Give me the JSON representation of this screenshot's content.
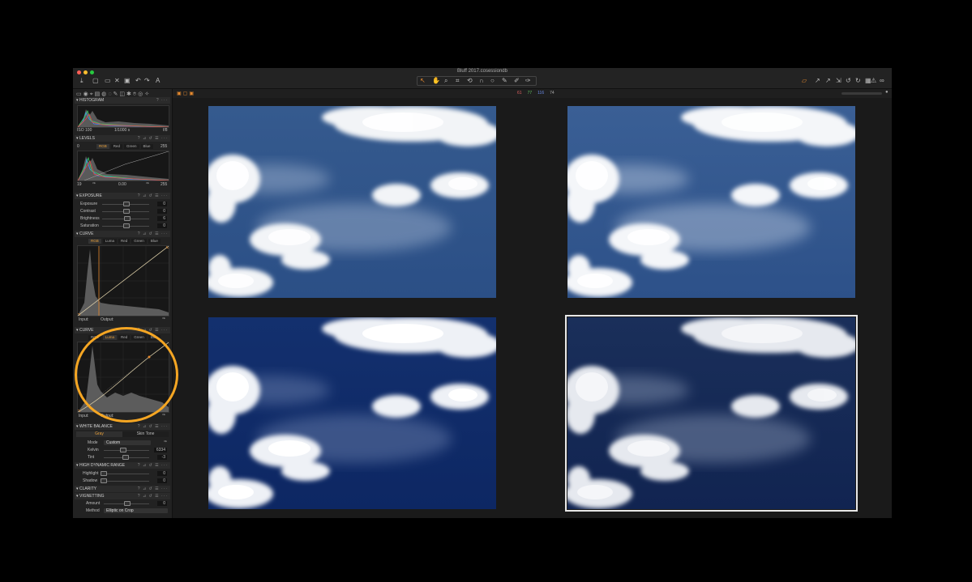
{
  "window": {
    "title": "Bluff 2017.cosessiondb",
    "lights": [
      "#ff5f56",
      "#ffbd2e",
      "#27c93f"
    ]
  },
  "toolbar": {
    "left_icons": [
      "import-icon",
      "camera-icon",
      "folder-icon",
      "close-icon",
      "undo-icon",
      "redo-icon",
      "text-icon"
    ],
    "center_tools": [
      "cursor-tool",
      "pan-tool",
      "zoom-tool",
      "crop-tool",
      "rotate-tool",
      "keystone-tool",
      "spot-tool",
      "brush-tool",
      "eraser-tool",
      "picker-tool"
    ],
    "right_icons": [
      "layers-icon",
      "arrow-icon",
      "edit-icon",
      "reset-icon",
      "redo-icon",
      "grid-icon",
      "warning-icon",
      "glasses-icon"
    ],
    "accent": "#e68a2e"
  },
  "readout": {
    "r": "61",
    "g": "77",
    "b": "116",
    "l": "74"
  },
  "histogram": {
    "title": "HISTOGRAM",
    "iso": "ISO 100",
    "shutter": "1/1000 s",
    "aperture": "f/8"
  },
  "levels": {
    "title": "LEVELS",
    "low": "0",
    "high": "255",
    "tabs": [
      "RGB",
      "Red",
      "Green",
      "Blue"
    ],
    "out_low": "19",
    "mid": "0.00",
    "out_high": "255"
  },
  "exposure": {
    "title": "EXPOSURE",
    "rows": [
      {
        "label": "Exposure",
        "value": "0"
      },
      {
        "label": "Contrast",
        "value": "0"
      },
      {
        "label": "Brightness",
        "value": "6"
      },
      {
        "label": "Saturation",
        "value": "0"
      }
    ]
  },
  "curve1": {
    "title": "CURVE",
    "tabs": [
      "RGB",
      "Luma",
      "Red",
      "Green",
      "Blue"
    ],
    "input": "Input:",
    "output": "Output:"
  },
  "curve2": {
    "title": "CURVE",
    "tabs": [
      "RGB",
      "Luma",
      "Red",
      "Green",
      "Blue"
    ],
    "input": "Input:",
    "output": "Output:"
  },
  "white_balance": {
    "title": "WHITE BALANCE",
    "tabs": [
      "Gray",
      "Skin Tone"
    ],
    "mode_label": "Mode",
    "mode_value": "Custom",
    "kelvin_label": "Kelvin",
    "kelvin_value": "6334",
    "tint_label": "Tint",
    "tint_value": "-3"
  },
  "hdr": {
    "title": "HIGH DYNAMIC RANGE",
    "highlight_label": "Highlight",
    "highlight_value": "0",
    "shadow_label": "Shadow",
    "shadow_value": "0"
  },
  "clarity": {
    "title": "CLARITY"
  },
  "vignetting": {
    "title": "VIGNETTING",
    "amount_label": "Amount",
    "amount_value": "0",
    "method_label": "Method",
    "method_value": "Elliptic on Crop"
  },
  "photos": [
    {
      "name": "variant-1",
      "sky_top": "#355a8e",
      "sky_bottom": "#2b4f86",
      "selected": false
    },
    {
      "name": "variant-2",
      "sky_top": "#3a5f95",
      "sky_bottom": "#2d5189",
      "selected": false
    },
    {
      "name": "variant-3",
      "sky_top": "#13306e",
      "sky_bottom": "#0d2763",
      "selected": false
    },
    {
      "name": "variant-4",
      "sky_top": "#1a2f5a",
      "sky_bottom": "#112451",
      "selected": true
    }
  ]
}
